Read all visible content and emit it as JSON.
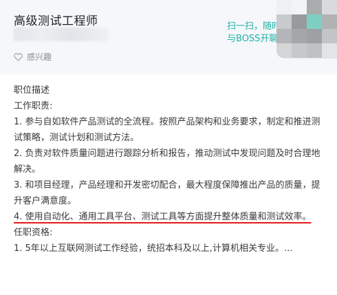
{
  "job": {
    "title": "高级测试工程师",
    "interest_label": "感兴趣"
  },
  "scan_prompt": {
    "line1": "扫一扫，随时",
    "line2": "与BOSS开聊"
  },
  "description": {
    "heading": "职位描述",
    "duties_heading": "工作职责:",
    "duties": [
      "1. 参与自如软件产品测试的全流程。按照产品架构和业务要求，制定和推进测试策略，测试计划和测试方法。",
      "2. 负责对软件质量问题进行跟踪分析和报告，推动测试中发现问题及时合理地解决。",
      "3. 和项目经理，产品经理和开发密切配合，最大程度保障推出产品的质量，提升客户满意度。",
      "4. 使用自动化、通用工具平台、测试工具等方面提升整体质量和测试效率。"
    ],
    "requirements_heading": "任职资格:",
    "requirements": [
      "1. 5年以上互联网测试工作经验，统招本科及以上,计算机相关专业。..."
    ]
  },
  "colors": {
    "accent": "#1fb3a5",
    "underline": "#e01a1a",
    "header_bg": "#f5f7fb"
  },
  "icons": {
    "interest": "heart-icon"
  }
}
